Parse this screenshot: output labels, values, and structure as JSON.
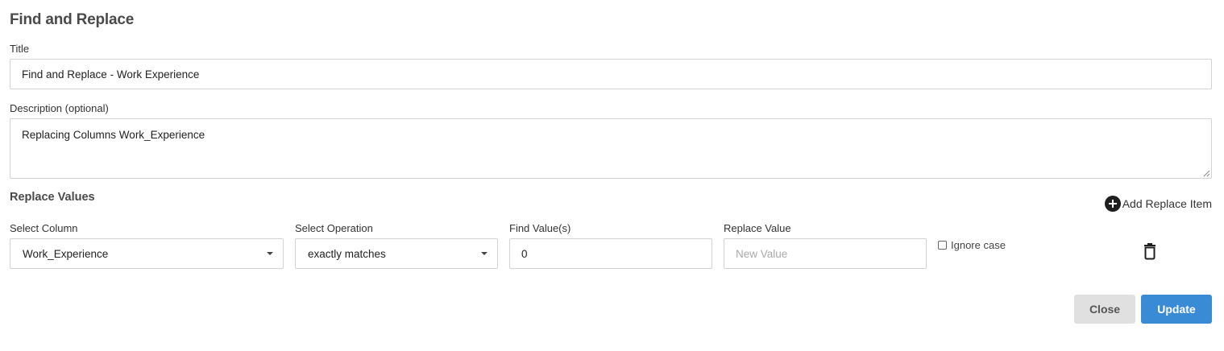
{
  "dialog": {
    "title": "Find and Replace"
  },
  "form": {
    "title_label": "Title",
    "title_value": "Find and Replace - Work Experience",
    "description_label": "Description (optional)",
    "description_value": "Replacing Columns Work_Experience"
  },
  "replace": {
    "section_title": "Replace Values",
    "add_item_label": "Add Replace Item",
    "column_label": "Select Column",
    "column_value": "Work_Experience",
    "operation_label": "Select Operation",
    "operation_value": "exactly matches",
    "find_label": "Find Value(s)",
    "find_value": "0",
    "replace_label": "Replace Value",
    "replace_placeholder": "New Value",
    "ignore_case_label": "Ignore case",
    "ignore_case_checked": false
  },
  "footer": {
    "close_label": "Close",
    "update_label": "Update"
  },
  "colors": {
    "primary": "#3a8bd6",
    "secondary_button": "#e0e0e0",
    "border": "#d3d3d3"
  },
  "icons": {
    "add": "plus-circle-icon",
    "delete": "trash-icon",
    "dropdown": "caret-down-icon"
  }
}
